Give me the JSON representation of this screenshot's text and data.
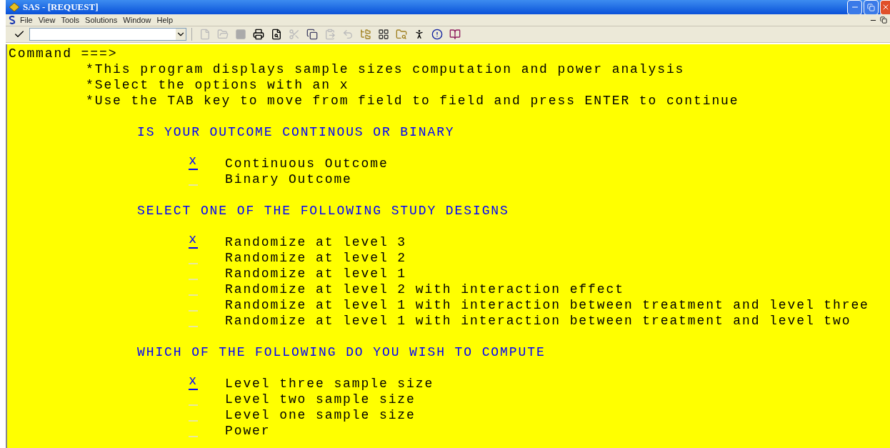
{
  "window": {
    "title": "SAS - [REQUEST]"
  },
  "menu": [
    "File",
    "View",
    "Tools",
    "Solutions",
    "Window",
    "Help"
  ],
  "command": {
    "label": "Command ===>"
  },
  "instructions": [
    "*This program displays sample sizes computation and power analysis",
    "*Select the options with an x",
    "*Use the TAB key to move from field to field and press ENTER to continue"
  ],
  "sections": [
    {
      "heading": "IS YOUR OUTCOME CONTINOUS OR BINARY",
      "options": [
        {
          "label": "Continuous Outcome",
          "selected": true,
          "value": "x"
        },
        {
          "label": "Binary Outcome",
          "selected": false
        }
      ]
    },
    {
      "heading": "SELECT ONE OF THE FOLLOWING STUDY DESIGNS",
      "options": [
        {
          "label": "Randomize at level 3",
          "selected": true,
          "value": "x"
        },
        {
          "label": "Randomize at level 2",
          "selected": false
        },
        {
          "label": "Randomize at level 1",
          "selected": false
        },
        {
          "label": "Randomize at level 2 with interaction effect",
          "selected": false
        },
        {
          "label": "Randomize at level 1 with interaction between treatment and level three",
          "selected": false
        },
        {
          "label": "Randomize at level 1 with interaction between treatment and level two",
          "selected": false
        }
      ]
    },
    {
      "heading": "WHICH OF THE FOLLOWING DO YOU WISH TO COMPUTE",
      "options": [
        {
          "label": "Level three sample size",
          "selected": true,
          "value": "x"
        },
        {
          "label": "Level two sample size",
          "selected": false
        },
        {
          "label": "Level one sample size",
          "selected": false
        },
        {
          "label": "Power",
          "selected": false
        }
      ]
    }
  ]
}
